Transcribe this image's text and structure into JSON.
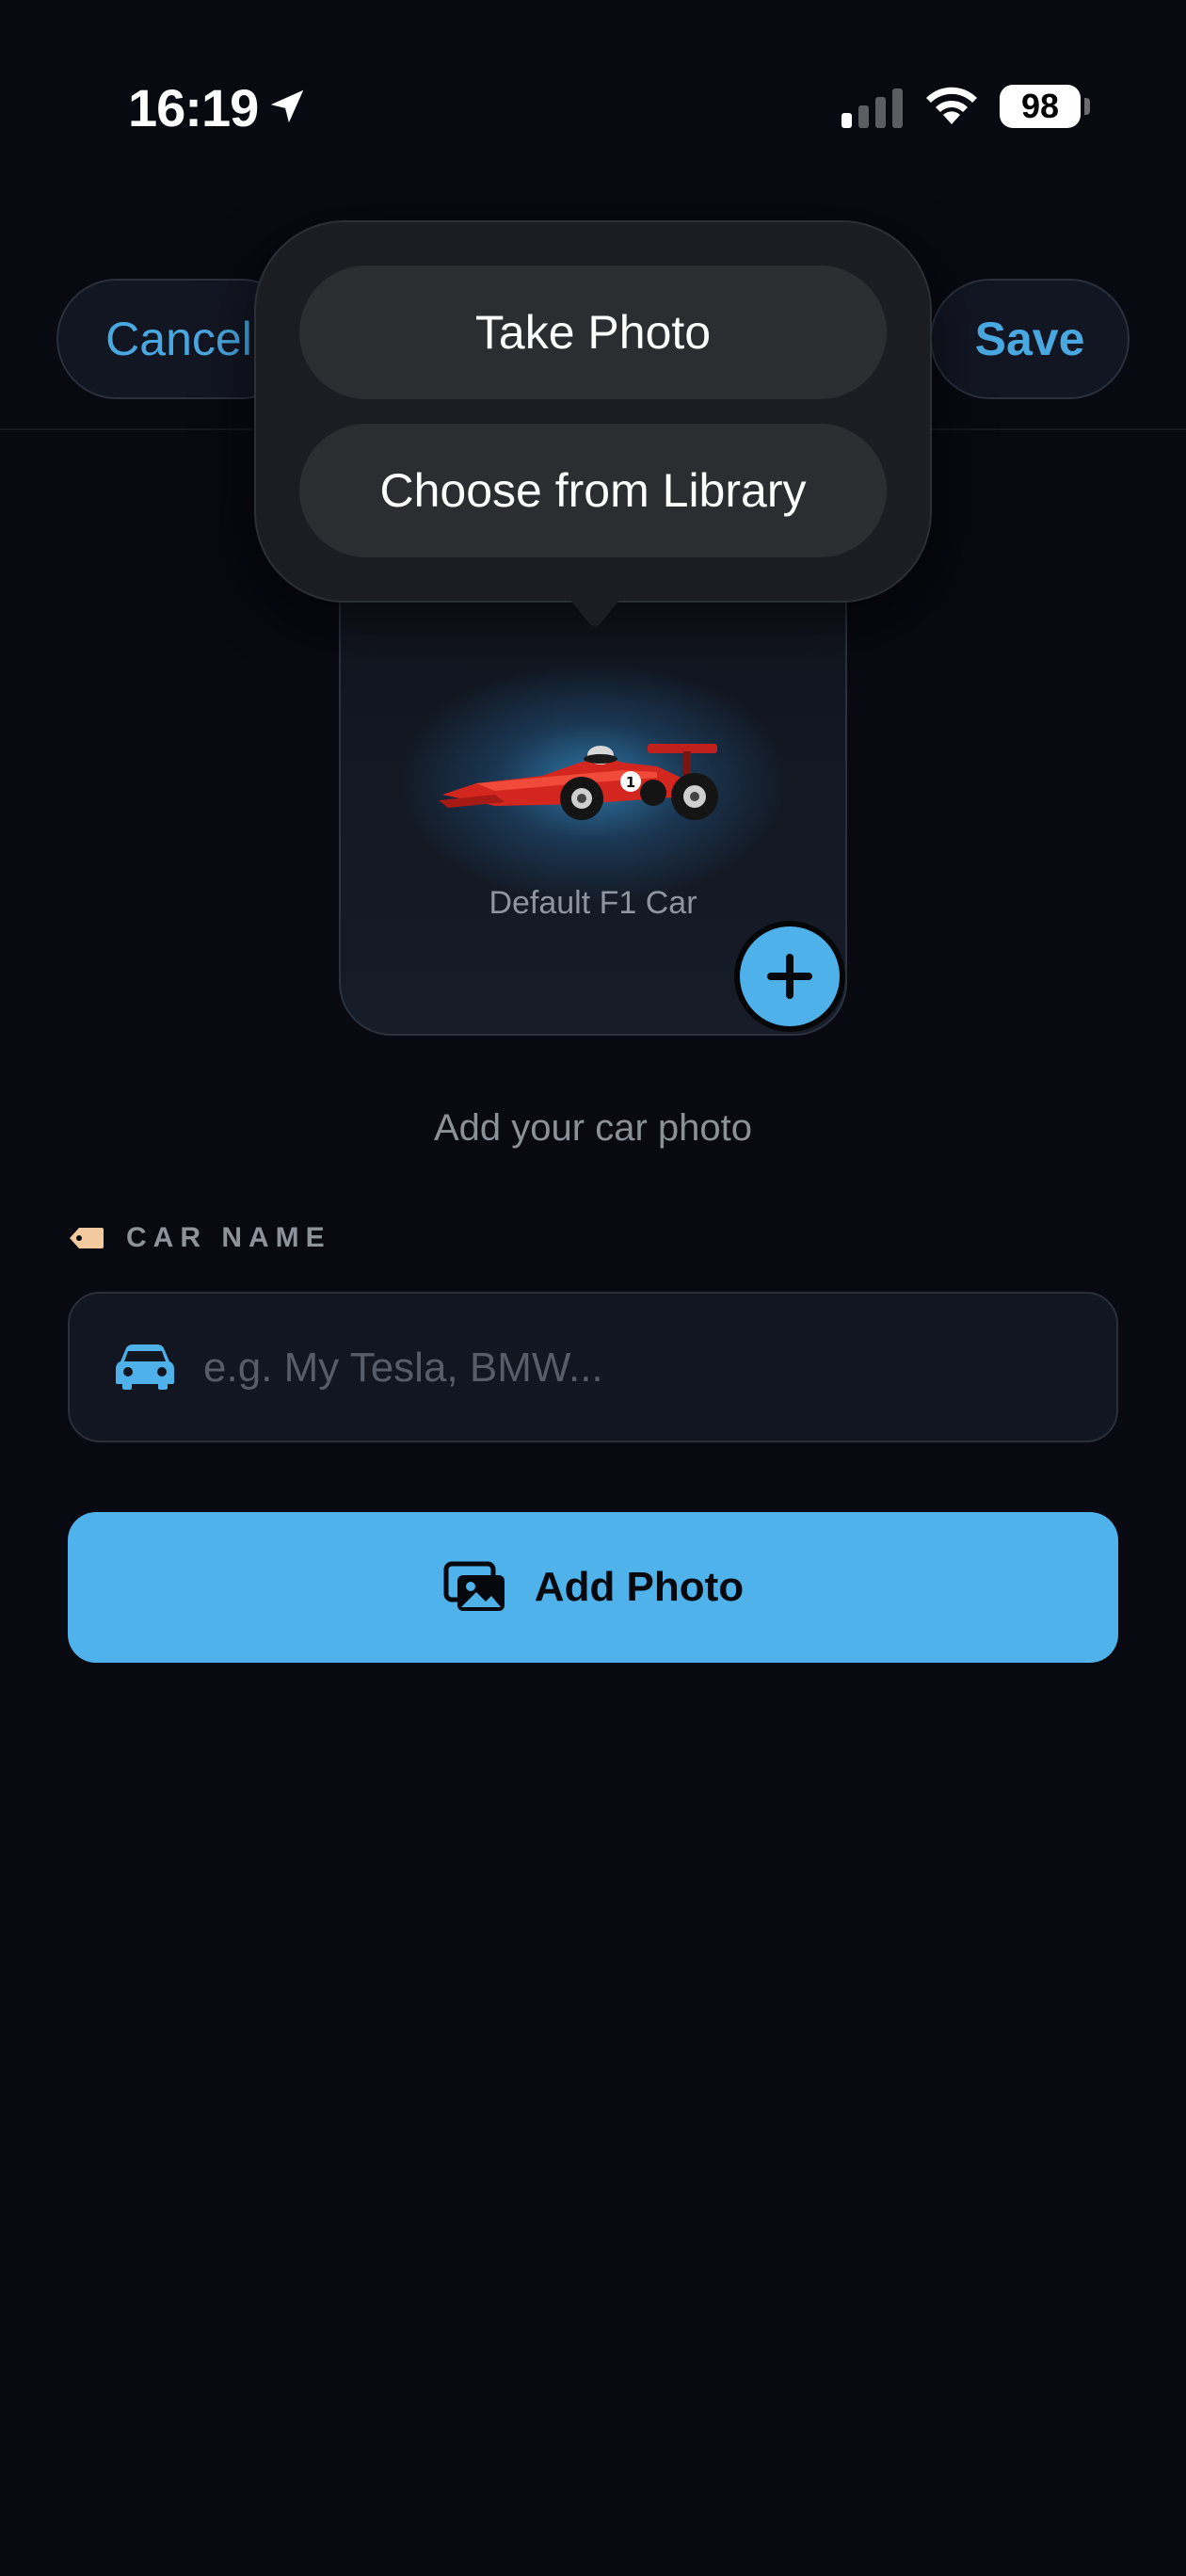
{
  "status_bar": {
    "time": "16:19",
    "battery": "98"
  },
  "nav": {
    "cancel_label": "Cancel",
    "save_label": "Save"
  },
  "photo_menu": {
    "items": [
      {
        "label": "Take Photo"
      },
      {
        "label": "Choose from Library"
      }
    ]
  },
  "photo_card": {
    "caption": "Default F1 Car"
  },
  "hint": "Add your car photo",
  "car_name": {
    "label": "CAR NAME",
    "value": "",
    "placeholder": "e.g. My Tesla, BMW..."
  },
  "add_photo_button": {
    "label": "Add Photo"
  },
  "colors": {
    "background": "#080911",
    "accent": "#50b2ea",
    "link": "#4aa8e0",
    "menu_surface": "#1b1d22",
    "tag": "#f3c9a0"
  },
  "icons": {
    "location": "location-arrow-icon",
    "signal": "cellular-signal-icon",
    "wifi": "wifi-icon",
    "battery": "battery-icon",
    "car_image": "f1-car-image",
    "plus": "plus-icon",
    "tag": "tag-icon",
    "car": "car-icon",
    "photos": "photos-icon"
  }
}
